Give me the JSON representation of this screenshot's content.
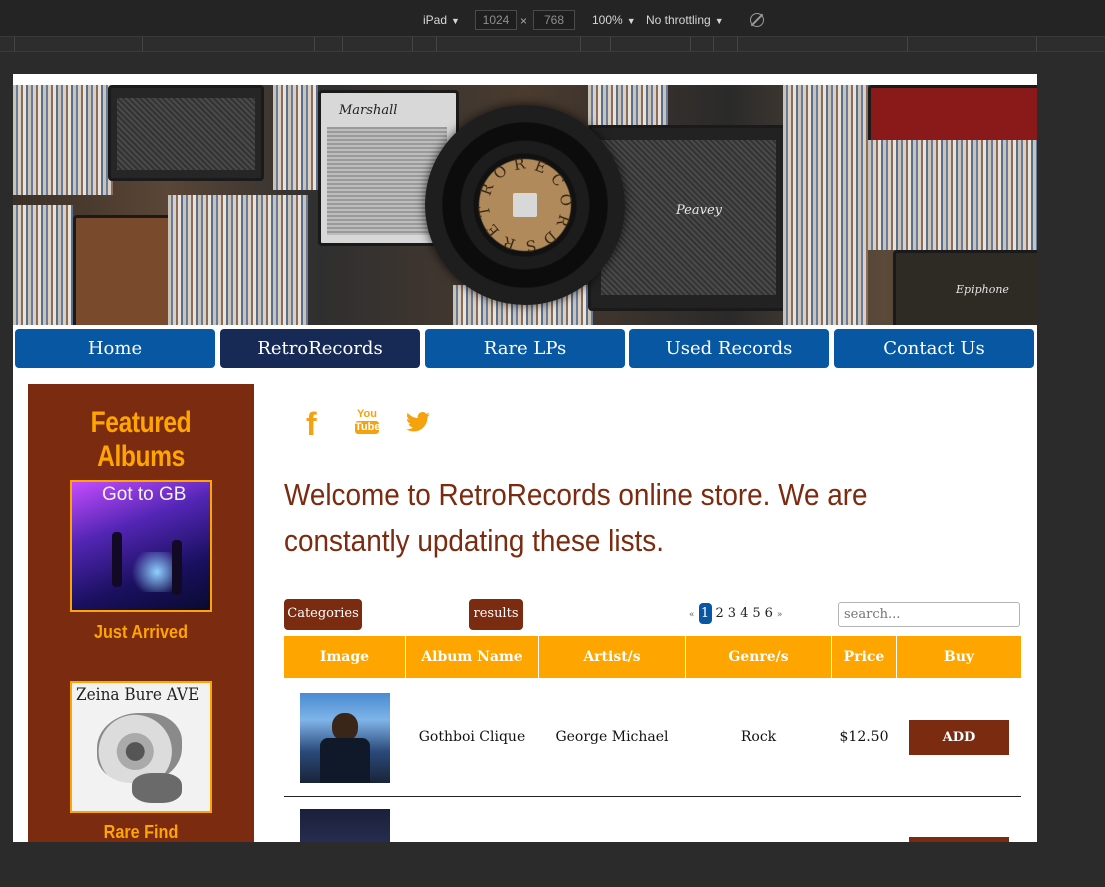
{
  "devtools": {
    "device": "iPad",
    "width": "1024",
    "height": "768",
    "zoom": "100%",
    "throttling": "No throttling",
    "separator": "×"
  },
  "nav": {
    "items": [
      "Home",
      "RetroRecords",
      "Rare LPs",
      "Used Records",
      "Contact Us"
    ],
    "active": "RetroRecords"
  },
  "sidebar": {
    "title": "Featured Albums",
    "albums": [
      {
        "cover_text": "Got to GB",
        "caption": "Just Arrived"
      },
      {
        "cover_text": "Zeina Bure AVE",
        "caption": "Rare Find"
      }
    ]
  },
  "social": {
    "facebook_glyph": "f",
    "youtube_top": "You",
    "youtube_bottom": "Tube"
  },
  "welcome": "Welcome to RetroRecords online store. We are constantly updating these lists.",
  "filters": {
    "categories": "Categories",
    "results": "results"
  },
  "pagination": {
    "prev": "«",
    "pages": [
      "1",
      "2",
      "3",
      "4",
      "5",
      "6"
    ],
    "current": "1",
    "next": "»"
  },
  "search": {
    "placeholder": "search..."
  },
  "table": {
    "headers": [
      "Image",
      "Album Name",
      "Artist/s",
      "Genre/s",
      "Price",
      "Buy"
    ],
    "rows": [
      {
        "album": "Gothboi Clique",
        "artist": "George Michael",
        "genre": "Rock",
        "price": "$12.50",
        "buy": "ADD"
      },
      {
        "album": "",
        "artist": "",
        "genre": "",
        "price": "",
        "buy": ""
      }
    ]
  },
  "colors": {
    "nav_blue": "#0857a3",
    "nav_active": "#172a55",
    "brown": "#7a2b10",
    "orange": "#ffa500"
  },
  "icons": [
    "dropdown-caret-icon",
    "rotate-icon",
    "facebook-icon",
    "youtube-icon",
    "twitter-icon"
  ]
}
